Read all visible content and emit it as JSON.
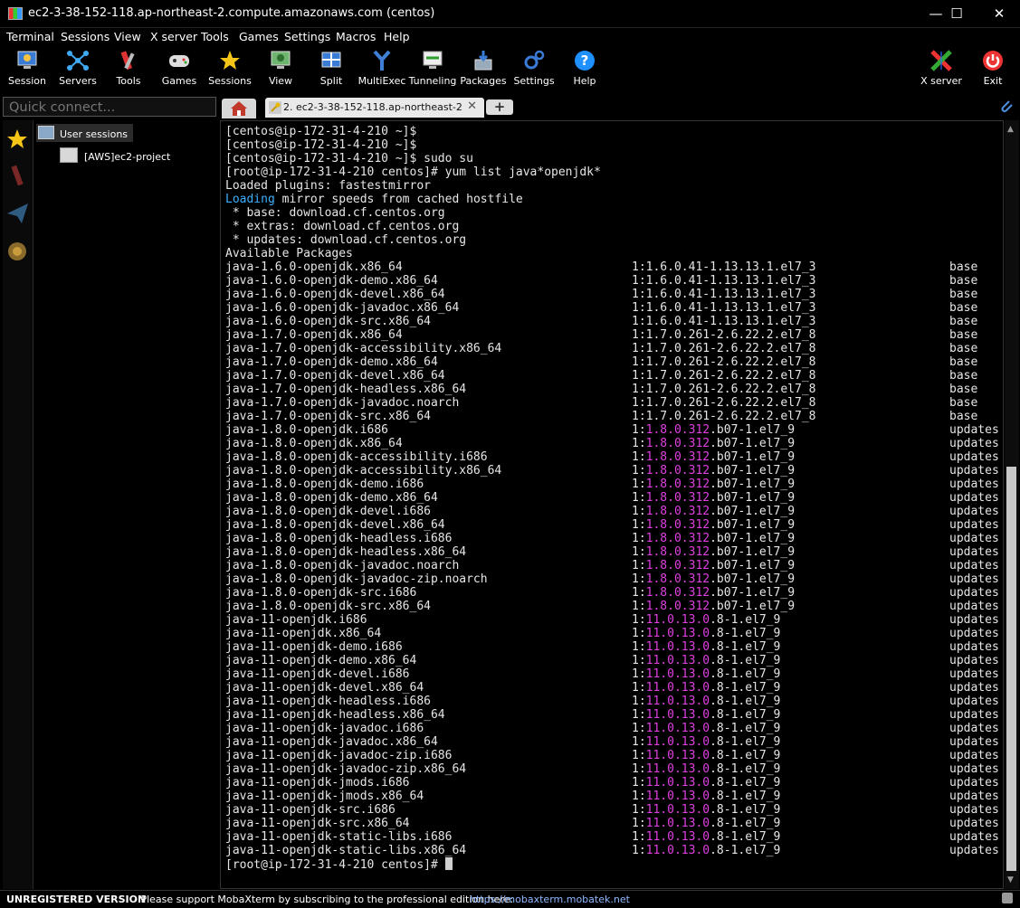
{
  "window": {
    "title": "ec2-3-38-152-118.ap-northeast-2.compute.amazonaws.com (centos)",
    "minimize": "—",
    "maximize": "☐",
    "close": "✕"
  },
  "menu": [
    "Terminal",
    "Sessions",
    "View",
    "X server",
    "Tools",
    "Games",
    "Settings",
    "Macros",
    "Help"
  ],
  "toolbar": {
    "session": "Session",
    "servers": "Servers",
    "tools": "Tools",
    "games": "Games",
    "sessions": "Sessions",
    "view": "View",
    "split": "Split",
    "multiexec": "MultiExec",
    "tunneling": "Tunneling",
    "packages": "Packages",
    "settings": "Settings",
    "help": "Help",
    "xserver": "X server",
    "exit": "Exit"
  },
  "quick_connect": {
    "placeholder": "Quick connect..."
  },
  "tabs": {
    "session_tab": "2. ec2-3-38-152-118.ap-northeast-2",
    "close": "✕",
    "new": "+"
  },
  "sidebar": {
    "user_sessions": "User sessions",
    "project": "[AWS]ec2-project"
  },
  "terminal": {
    "header_lines": [
      "[centos@ip-172-31-4-210 ~]$",
      "[centos@ip-172-31-4-210 ~]$",
      "[centos@ip-172-31-4-210 ~]$ sudo su",
      "[root@ip-172-31-4-210 centos]# yum list java*openjdk*",
      "Loaded plugins: fastestmirror"
    ],
    "loading_word": "Loading",
    "loading_rest": " mirror speeds from cached hostfile",
    "mirror_lines": [
      " * base: download.cf.centos.org",
      " * extras: download.cf.centos.org",
      " * updates: download.cf.centos.org",
      "Available Packages"
    ],
    "packages": [
      {
        "name": "java-1.6.0-openjdk.x86_64",
        "pre": "1:1.6.0.41-1.13.13.1.el7_3",
        "hl": "",
        "post": "",
        "repo": "base"
      },
      {
        "name": "java-1.6.0-openjdk-demo.x86_64",
        "pre": "1:1.6.0.41-1.13.13.1.el7_3",
        "hl": "",
        "post": "",
        "repo": "base"
      },
      {
        "name": "java-1.6.0-openjdk-devel.x86_64",
        "pre": "1:1.6.0.41-1.13.13.1.el7_3",
        "hl": "",
        "post": "",
        "repo": "base"
      },
      {
        "name": "java-1.6.0-openjdk-javadoc.x86_64",
        "pre": "1:1.6.0.41-1.13.13.1.el7_3",
        "hl": "",
        "post": "",
        "repo": "base"
      },
      {
        "name": "java-1.6.0-openjdk-src.x86_64",
        "pre": "1:1.6.0.41-1.13.13.1.el7_3",
        "hl": "",
        "post": "",
        "repo": "base"
      },
      {
        "name": "java-1.7.0-openjdk.x86_64",
        "pre": "1:1.7.0.261-2.6.22.2.el7_8",
        "hl": "",
        "post": "",
        "repo": "base"
      },
      {
        "name": "java-1.7.0-openjdk-accessibility.x86_64",
        "pre": "1:1.7.0.261-2.6.22.2.el7_8",
        "hl": "",
        "post": "",
        "repo": "base"
      },
      {
        "name": "java-1.7.0-openjdk-demo.x86_64",
        "pre": "1:1.7.0.261-2.6.22.2.el7_8",
        "hl": "",
        "post": "",
        "repo": "base"
      },
      {
        "name": "java-1.7.0-openjdk-devel.x86_64",
        "pre": "1:1.7.0.261-2.6.22.2.el7_8",
        "hl": "",
        "post": "",
        "repo": "base"
      },
      {
        "name": "java-1.7.0-openjdk-headless.x86_64",
        "pre": "1:1.7.0.261-2.6.22.2.el7_8",
        "hl": "",
        "post": "",
        "repo": "base"
      },
      {
        "name": "java-1.7.0-openjdk-javadoc.noarch",
        "pre": "1:1.7.0.261-2.6.22.2.el7_8",
        "hl": "",
        "post": "",
        "repo": "base"
      },
      {
        "name": "java-1.7.0-openjdk-src.x86_64",
        "pre": "1:1.7.0.261-2.6.22.2.el7_8",
        "hl": "",
        "post": "",
        "repo": "base"
      },
      {
        "name": "java-1.8.0-openjdk.i686",
        "pre": "1:",
        "hl": "1.8.0.312",
        "post": ".b07-1.el7_9",
        "repo": "updates"
      },
      {
        "name": "java-1.8.0-openjdk.x86_64",
        "pre": "1:",
        "hl": "1.8.0.312",
        "post": ".b07-1.el7_9",
        "repo": "updates"
      },
      {
        "name": "java-1.8.0-openjdk-accessibility.i686",
        "pre": "1:",
        "hl": "1.8.0.312",
        "post": ".b07-1.el7_9",
        "repo": "updates"
      },
      {
        "name": "java-1.8.0-openjdk-accessibility.x86_64",
        "pre": "1:",
        "hl": "1.8.0.312",
        "post": ".b07-1.el7_9",
        "repo": "updates"
      },
      {
        "name": "java-1.8.0-openjdk-demo.i686",
        "pre": "1:",
        "hl": "1.8.0.312",
        "post": ".b07-1.el7_9",
        "repo": "updates"
      },
      {
        "name": "java-1.8.0-openjdk-demo.x86_64",
        "pre": "1:",
        "hl": "1.8.0.312",
        "post": ".b07-1.el7_9",
        "repo": "updates"
      },
      {
        "name": "java-1.8.0-openjdk-devel.i686",
        "pre": "1:",
        "hl": "1.8.0.312",
        "post": ".b07-1.el7_9",
        "repo": "updates"
      },
      {
        "name": "java-1.8.0-openjdk-devel.x86_64",
        "pre": "1:",
        "hl": "1.8.0.312",
        "post": ".b07-1.el7_9",
        "repo": "updates"
      },
      {
        "name": "java-1.8.0-openjdk-headless.i686",
        "pre": "1:",
        "hl": "1.8.0.312",
        "post": ".b07-1.el7_9",
        "repo": "updates"
      },
      {
        "name": "java-1.8.0-openjdk-headless.x86_64",
        "pre": "1:",
        "hl": "1.8.0.312",
        "post": ".b07-1.el7_9",
        "repo": "updates"
      },
      {
        "name": "java-1.8.0-openjdk-javadoc.noarch",
        "pre": "1:",
        "hl": "1.8.0.312",
        "post": ".b07-1.el7_9",
        "repo": "updates"
      },
      {
        "name": "java-1.8.0-openjdk-javadoc-zip.noarch",
        "pre": "1:",
        "hl": "1.8.0.312",
        "post": ".b07-1.el7_9",
        "repo": "updates"
      },
      {
        "name": "java-1.8.0-openjdk-src.i686",
        "pre": "1:",
        "hl": "1.8.0.312",
        "post": ".b07-1.el7_9",
        "repo": "updates"
      },
      {
        "name": "java-1.8.0-openjdk-src.x86_64",
        "pre": "1:",
        "hl": "1.8.0.312",
        "post": ".b07-1.el7_9",
        "repo": "updates"
      },
      {
        "name": "java-11-openjdk.i686",
        "pre": "1:",
        "hl": "11.0.13.0",
        "post": ".8-1.el7_9",
        "repo": "updates"
      },
      {
        "name": "java-11-openjdk.x86_64",
        "pre": "1:",
        "hl": "11.0.13.0",
        "post": ".8-1.el7_9",
        "repo": "updates"
      },
      {
        "name": "java-11-openjdk-demo.i686",
        "pre": "1:",
        "hl": "11.0.13.0",
        "post": ".8-1.el7_9",
        "repo": "updates"
      },
      {
        "name": "java-11-openjdk-demo.x86_64",
        "pre": "1:",
        "hl": "11.0.13.0",
        "post": ".8-1.el7_9",
        "repo": "updates"
      },
      {
        "name": "java-11-openjdk-devel.i686",
        "pre": "1:",
        "hl": "11.0.13.0",
        "post": ".8-1.el7_9",
        "repo": "updates"
      },
      {
        "name": "java-11-openjdk-devel.x86_64",
        "pre": "1:",
        "hl": "11.0.13.0",
        "post": ".8-1.el7_9",
        "repo": "updates"
      },
      {
        "name": "java-11-openjdk-headless.i686",
        "pre": "1:",
        "hl": "11.0.13.0",
        "post": ".8-1.el7_9",
        "repo": "updates"
      },
      {
        "name": "java-11-openjdk-headless.x86_64",
        "pre": "1:",
        "hl": "11.0.13.0",
        "post": ".8-1.el7_9",
        "repo": "updates"
      },
      {
        "name": "java-11-openjdk-javadoc.i686",
        "pre": "1:",
        "hl": "11.0.13.0",
        "post": ".8-1.el7_9",
        "repo": "updates"
      },
      {
        "name": "java-11-openjdk-javadoc.x86_64",
        "pre": "1:",
        "hl": "11.0.13.0",
        "post": ".8-1.el7_9",
        "repo": "updates"
      },
      {
        "name": "java-11-openjdk-javadoc-zip.i686",
        "pre": "1:",
        "hl": "11.0.13.0",
        "post": ".8-1.el7_9",
        "repo": "updates"
      },
      {
        "name": "java-11-openjdk-javadoc-zip.x86_64",
        "pre": "1:",
        "hl": "11.0.13.0",
        "post": ".8-1.el7_9",
        "repo": "updates"
      },
      {
        "name": "java-11-openjdk-jmods.i686",
        "pre": "1:",
        "hl": "11.0.13.0",
        "post": ".8-1.el7_9",
        "repo": "updates"
      },
      {
        "name": "java-11-openjdk-jmods.x86_64",
        "pre": "1:",
        "hl": "11.0.13.0",
        "post": ".8-1.el7_9",
        "repo": "updates"
      },
      {
        "name": "java-11-openjdk-src.i686",
        "pre": "1:",
        "hl": "11.0.13.0",
        "post": ".8-1.el7_9",
        "repo": "updates"
      },
      {
        "name": "java-11-openjdk-src.x86_64",
        "pre": "1:",
        "hl": "11.0.13.0",
        "post": ".8-1.el7_9",
        "repo": "updates"
      },
      {
        "name": "java-11-openjdk-static-libs.i686",
        "pre": "1:",
        "hl": "11.0.13.0",
        "post": ".8-1.el7_9",
        "repo": "updates"
      },
      {
        "name": "java-11-openjdk-static-libs.x86_64",
        "pre": "1:",
        "hl": "11.0.13.0",
        "post": ".8-1.el7_9",
        "repo": "updates"
      }
    ],
    "prompt": "[root@ip-172-31-4-210 centos]# "
  },
  "status": {
    "unregistered": "UNREGISTERED VERSION",
    "message": "-  Please support MobaXterm by subscribing to the professional edition here:",
    "link": "https://mobaxterm.mobatek.net"
  },
  "colors": {
    "highlight": "#e040e0",
    "loading": "#3ab0ff",
    "background": "#000000"
  }
}
